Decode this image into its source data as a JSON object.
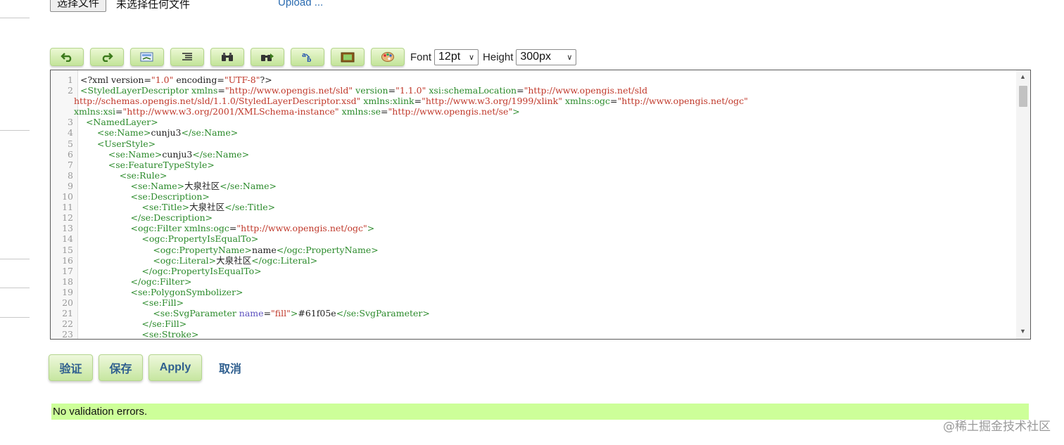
{
  "upload": {
    "choose_file_label": "选择文件",
    "file_status": "未选择任何文件",
    "upload_link": "Upload ..."
  },
  "toolbar": {
    "buttons": [
      {
        "icon": "undo-icon"
      },
      {
        "icon": "redo-icon"
      },
      {
        "icon": "goto-line-icon"
      },
      {
        "icon": "reindent-icon"
      },
      {
        "icon": "find-icon"
      },
      {
        "icon": "find-replace-icon"
      },
      {
        "icon": "text-replace-icon"
      },
      {
        "icon": "fullscreen-icon"
      },
      {
        "icon": "color-palette-icon"
      }
    ],
    "font_label": "Font",
    "font_value": "12pt",
    "height_label": "Height",
    "height_value": "300px"
  },
  "editor": {
    "lines": [
      {
        "n": "1",
        "html": "<span class=\"x\">&lt;?xml version=</span><span class=\"s\">\"1.0\"</span><span class=\"x\"> encoding=</span><span class=\"s\">\"UTF-8\"</span><span class=\"x\">?&gt;</span>"
      },
      {
        "n": "2",
        "html": "<span class=\"t\">&lt;StyledLayerDescriptor</span> <span class=\"a\">xmlns</span>=<span class=\"s\">\"http://www.opengis.net/sld\"</span> <span class=\"a\">version</span>=<span class=\"s\">\"1.1.0\"</span> <span class=\"a\">xsi:schemaLocation</span>=<span class=\"s\">\"http://www.opengis.net/sld</span>"
      },
      {
        "n": "",
        "cont": true,
        "html": "<span class=\"s\">http://schemas.opengis.net/sld/1.1.0/StyledLayerDescriptor.xsd\"</span> <span class=\"a\">xmlns:xlink</span>=<span class=\"s\">\"http://www.w3.org/1999/xlink\"</span> <span class=\"a\">xmlns:ogc</span>=<span class=\"s\">\"http://www.opengis.net/ogc\"</span>"
      },
      {
        "n": "",
        "cont": true,
        "html": "<span class=\"a\">xmlns:xsi</span>=<span class=\"s\">\"http://www.w3.org/2001/XMLSchema-instance\"</span> <span class=\"a\">xmlns:se</span>=<span class=\"s\">\"http://www.opengis.net/se\"</span><span class=\"t\">&gt;</span>"
      },
      {
        "n": "3",
        "html": "  <span class=\"t\">&lt;NamedLayer&gt;</span>"
      },
      {
        "n": "4",
        "html": "      <span class=\"t\">&lt;se:Name&gt;</span>cunju3<span class=\"t\">&lt;/se:Name&gt;</span>"
      },
      {
        "n": "5",
        "html": "      <span class=\"t\">&lt;UserStyle&gt;</span>"
      },
      {
        "n": "6",
        "html": "          <span class=\"t\">&lt;se:Name&gt;</span>cunju3<span class=\"t\">&lt;/se:Name&gt;</span>"
      },
      {
        "n": "7",
        "html": "          <span class=\"t\">&lt;se:FeatureTypeStyle&gt;</span>"
      },
      {
        "n": "8",
        "html": "              <span class=\"t\">&lt;se:Rule&gt;</span>"
      },
      {
        "n": "9",
        "html": "                  <span class=\"t\">&lt;se:Name&gt;</span>大泉社区<span class=\"t\">&lt;/se:Name&gt;</span>"
      },
      {
        "n": "10",
        "html": "                  <span class=\"t\">&lt;se:Description&gt;</span>"
      },
      {
        "n": "11",
        "html": "                      <span class=\"t\">&lt;se:Title&gt;</span>大泉社区<span class=\"t\">&lt;/se:Title&gt;</span>"
      },
      {
        "n": "12",
        "html": "                  <span class=\"t\">&lt;/se:Description&gt;</span>"
      },
      {
        "n": "13",
        "html": "                  <span class=\"t\">&lt;ogc:Filter</span> <span class=\"a\">xmlns:ogc</span>=<span class=\"s\">\"http://www.opengis.net/ogc\"</span><span class=\"t\">&gt;</span>"
      },
      {
        "n": "14",
        "html": "                      <span class=\"t\">&lt;ogc:PropertyIsEqualTo&gt;</span>"
      },
      {
        "n": "15",
        "html": "                          <span class=\"t\">&lt;ogc:PropertyName&gt;</span>name<span class=\"t\">&lt;/ogc:PropertyName&gt;</span>"
      },
      {
        "n": "16",
        "html": "                          <span class=\"t\">&lt;ogc:Literal&gt;</span>大泉社区<span class=\"t\">&lt;/ogc:Literal&gt;</span>"
      },
      {
        "n": "17",
        "html": "                      <span class=\"t\">&lt;/ogc:PropertyIsEqualTo&gt;</span>"
      },
      {
        "n": "18",
        "html": "                  <span class=\"t\">&lt;/ogc:Filter&gt;</span>"
      },
      {
        "n": "19",
        "html": "                  <span class=\"t\">&lt;se:PolygonSymbolizer&gt;</span>"
      },
      {
        "n": "20",
        "html": "                      <span class=\"t\">&lt;se:Fill&gt;</span>"
      },
      {
        "n": "21",
        "html": "                          <span class=\"t\">&lt;se:SvgParameter</span> <span class=\"a\" style=\"color:#5a4fbf\">name</span>=<span class=\"s\">\"fill\"</span><span class=\"t\">&gt;</span>#61f05e<span class=\"t\">&lt;/se:SvgParameter&gt;</span>"
      },
      {
        "n": "22",
        "html": "                      <span class=\"t\">&lt;/se:Fill&gt;</span>"
      },
      {
        "n": "23",
        "html": "                      <span class=\"t\">&lt;se:Stroke&gt;</span>"
      }
    ]
  },
  "actions": {
    "validate_label": "验证",
    "save_label": "保存",
    "apply_label": "Apply",
    "cancel_label": "取消"
  },
  "status": {
    "message": "No validation errors."
  },
  "watermark": "@稀土掘金技术社区"
}
